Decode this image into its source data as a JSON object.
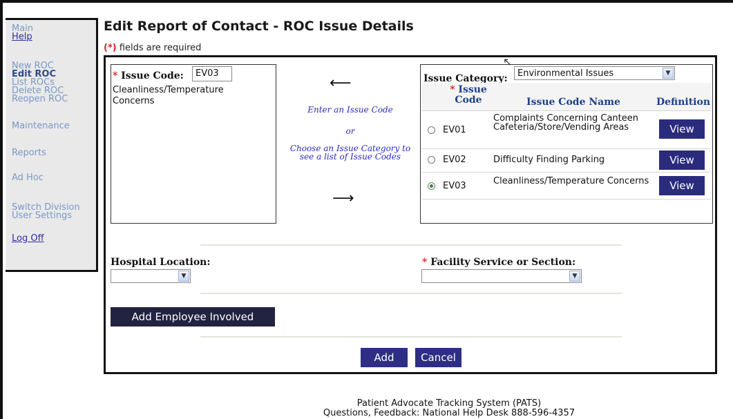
{
  "sidebar": {
    "main": "Main",
    "help": "Help",
    "new_roc": "New ROC",
    "edit_roc": "Edit ROC",
    "list_rocs": "List ROCs",
    "delete_roc": "Delete ROC",
    "reopen_roc": "Reopen ROC",
    "maintenance": "Maintenance",
    "reports": "Reports",
    "ad_hoc": "Ad Hoc",
    "switch_division": "Switch Division",
    "user_settings": "User Settings",
    "log_off": "Log Off"
  },
  "page": {
    "title": "Edit Report of Contact - ROC Issue Details",
    "req_star": "(*)",
    "req_text": " fields are required"
  },
  "issue": {
    "star": "*",
    "label": "Issue Code:",
    "value": "EV03",
    "description": "Cleanliness/Temperature Concerns"
  },
  "hint": {
    "line1": "Enter an Issue Code",
    "or": "or",
    "line2": "Choose an Issue Category to see a list of Issue Codes"
  },
  "category": {
    "label": "Issue Category:",
    "selected": "Environmental Issues",
    "headers": {
      "star": "*",
      "code": "Issue Code",
      "name": "Issue Code Name",
      "definition": "Definition"
    },
    "rows": [
      {
        "code": "EV01",
        "name": "Complaints Concerning Canteen Cafeteria/Store/Vending Areas",
        "button": "View",
        "selected": false
      },
      {
        "code": "EV02",
        "name": "Difficulty Finding Parking",
        "button": "View",
        "selected": false
      },
      {
        "code": "EV03",
        "name": "Cleanliness/Temperature Concerns",
        "button": "View",
        "selected": true
      }
    ]
  },
  "form": {
    "hospital_location_label": "Hospital Location:",
    "hospital_location_value": "",
    "facility_star": "*",
    "facility_label": "Facility Service or Section:",
    "facility_value": "",
    "add_employee": "Add Employee Involved",
    "add": "Add",
    "cancel": "Cancel"
  },
  "footer": {
    "line1": "Patient Advocate Tracking System (PATS)",
    "line2": "Questions, Feedback: National Help Desk   888-596-4357"
  },
  "colors": {
    "button_blue": "#2e2e86",
    "header_blue": "#1d3f8a",
    "required_red": "#d62020",
    "sidebar_bg": "#e9e9e9"
  }
}
